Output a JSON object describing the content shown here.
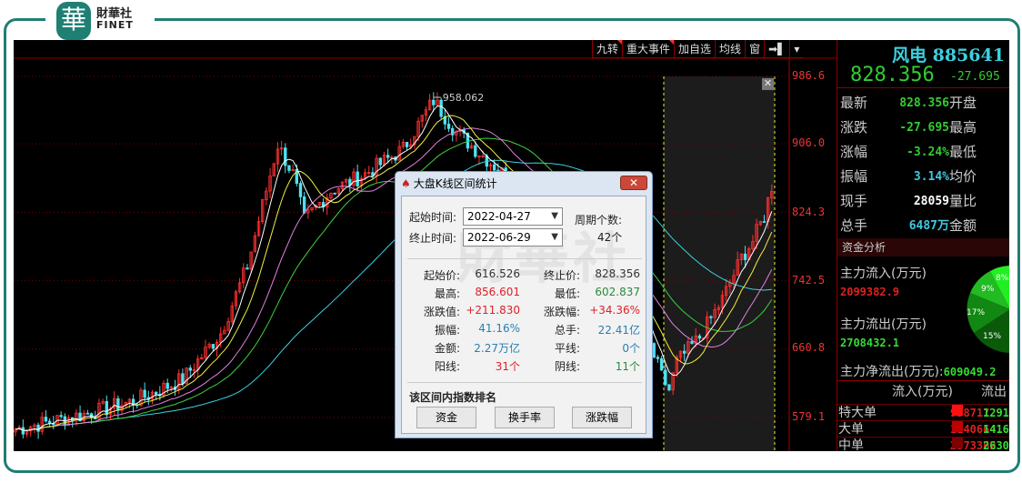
{
  "brand": {
    "logo_char": "華",
    "name_cn": "財華社",
    "name_en": "FINET"
  },
  "toolbar": [
    "九转",
    "重大事件",
    "加自选",
    "均线",
    "窗",
    "➡▌",
    "▾"
  ],
  "axis_labels": [
    "986.6",
    "906.0",
    "824.3",
    "742.5",
    "660.8",
    "579.1"
  ],
  "chart_data": {
    "type": "candlestick",
    "high_label": "958.062",
    "ylim": [
      579.1,
      986.6
    ],
    "price_anchors": [
      [
        0,
        565
      ],
      [
        20,
        585
      ],
      [
        32,
        600
      ],
      [
        44,
        625
      ],
      [
        54,
        680
      ],
      [
        61,
        760
      ],
      [
        69,
        905
      ],
      [
        73,
        870
      ],
      [
        76,
        815
      ],
      [
        83,
        850
      ],
      [
        92,
        870
      ],
      [
        102,
        900
      ],
      [
        110,
        958
      ],
      [
        116,
        920
      ],
      [
        126,
        880
      ],
      [
        140,
        820
      ],
      [
        152,
        760
      ],
      [
        164,
        700
      ],
      [
        170,
        628
      ],
      [
        172,
        612
      ],
      [
        174,
        645
      ],
      [
        180,
        675
      ],
      [
        186,
        720
      ],
      [
        191,
        770
      ],
      [
        194,
        790
      ],
      [
        197,
        820
      ],
      [
        199,
        856
      ]
    ],
    "ma_colors": {
      "ma5": "#ffffff",
      "ma10": "#f0f040",
      "ma20": "#e080e0",
      "ma30": "#40d040",
      "ma60": "#40d0e0"
    }
  },
  "quote": {
    "title": "风电 885641",
    "price": "828.356",
    "change": "-27.695",
    "rows": [
      {
        "k": "最新",
        "v": "828.356",
        "k2": "开盘",
        "color": "#33cc33"
      },
      {
        "k": "涨跌",
        "v": "-27.695",
        "k2": "最高",
        "color": "#33cc33"
      },
      {
        "k": "涨幅",
        "v": "-3.24%",
        "k2": "最低",
        "color": "#33cc33"
      },
      {
        "k": "振幅",
        "v": "3.14%",
        "k2": "均价",
        "color": "#40c8e0"
      },
      {
        "k": "现手",
        "v": "28059",
        "k2": "量比",
        "color": "#ffffff"
      },
      {
        "k": "总手",
        "v": "6487万",
        "k2": "金额",
        "color": "#40c8e0"
      }
    ]
  },
  "fund": {
    "section": "资金分析",
    "inflow_label": "主力流入(万元)",
    "inflow": "2099382.9",
    "outflow_label": "主力流出(万元)",
    "outflow": "2708432.1",
    "net_label": "主力净流出(万元):",
    "net": "609049.2",
    "pie": [
      {
        "label": "8%",
        "color": "#22ee22"
      },
      {
        "label": "9%",
        "color": "#22bb22"
      },
      {
        "label": "17%",
        "color": "#118811"
      },
      {
        "label": "15%",
        "color": "#0a5a0a"
      }
    ],
    "col_in": "流入(万元)",
    "col_out": "流出",
    "rows": [
      {
        "k": "特大单",
        "in": "958717",
        "out": "1291",
        "sw": "#ff1010"
      },
      {
        "k": "大单",
        "in": "1140664",
        "out": "1416",
        "sw": "#c00000"
      },
      {
        "k": "中单",
        "in": "2573362",
        "out": "2630",
        "sw": "#800000"
      }
    ]
  },
  "dialog": {
    "title": "大盘K线区间统计",
    "close": "✕",
    "start_label": "起始时间:",
    "start": "2022-04-27",
    "end_label": "终止时间:",
    "end": "2022-06-29",
    "period_label": "周期个数:",
    "period": "42个",
    "stats": [
      {
        "k": "起始价:",
        "v": "616.526",
        "c": "gray",
        "k2": "终止价:",
        "v2": "828.356",
        "c2": "gray"
      },
      {
        "k": "最高:",
        "v": "856.601",
        "c": "red",
        "k2": "最低:",
        "v2": "602.837",
        "c2": "green"
      },
      {
        "k": "涨跌值:",
        "v": "+211.830",
        "c": "red",
        "k2": "涨跌幅:",
        "v2": "+34.36%",
        "c2": "red"
      },
      {
        "k": "振幅:",
        "v": "41.16%",
        "c": "blue",
        "k2": "总手:",
        "v2": "22.41亿",
        "c2": "blue"
      },
      {
        "k": "金额:",
        "v": "2.27万亿",
        "c": "blue",
        "k2": "平线:",
        "v2": "0个",
        "c2": "blue"
      },
      {
        "k": "阳线:",
        "v": "31个",
        "c": "red",
        "k2": "阴线:",
        "v2": "11个",
        "c2": "green"
      }
    ],
    "rank_title": "该区间内指数排名",
    "buttons": [
      "资金",
      "换手率",
      "涨跌幅"
    ]
  }
}
